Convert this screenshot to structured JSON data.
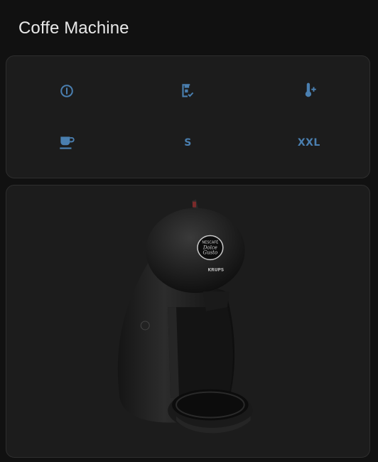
{
  "card": {
    "title": "Coffe Machine"
  },
  "controls": [
    {
      "name": "power",
      "icon": "power-icon"
    },
    {
      "name": "descale",
      "icon": "coffee-maker-check-icon"
    },
    {
      "name": "temperature",
      "icon": "thermometer-plus-icon"
    },
    {
      "name": "brew",
      "icon": "coffee-cup-icon"
    },
    {
      "name": "size_s",
      "label": "S"
    },
    {
      "name": "size_xxl",
      "label": "XXL"
    }
  ],
  "colors": {
    "icon": "#4a7fb0",
    "background": "#111111",
    "card": "#1c1c1c"
  },
  "image": {
    "brand_logo": "NESCAFE Dolce Gusto",
    "maker": "KRUPS"
  }
}
